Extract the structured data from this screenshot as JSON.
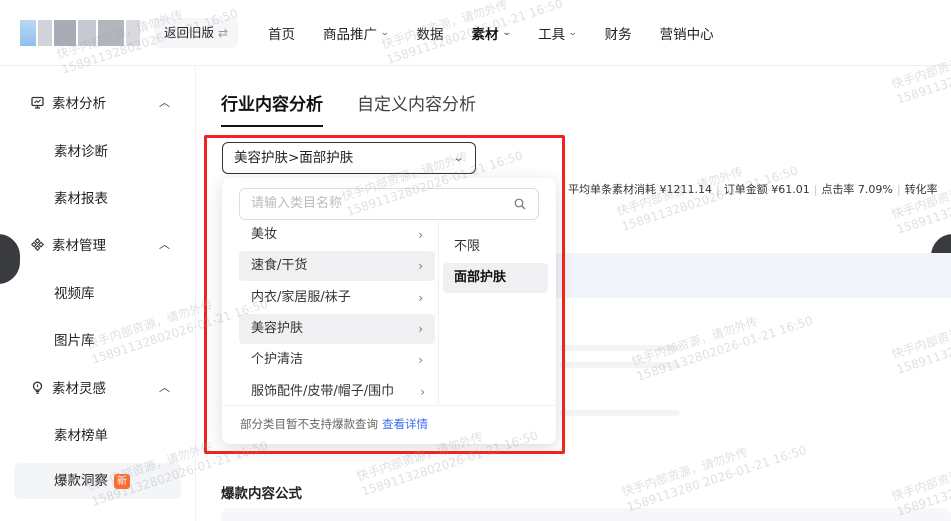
{
  "topbar": {
    "back_old_label": "返回旧版",
    "back_old_icon": "swap-icon",
    "nav": [
      {
        "label": "首页",
        "has_chevron": false,
        "active": false
      },
      {
        "label": "商品推广",
        "has_chevron": true,
        "active": false
      },
      {
        "label": "数据",
        "has_chevron": false,
        "active": false
      },
      {
        "label": "素材",
        "has_chevron": true,
        "active": true
      },
      {
        "label": "工具",
        "has_chevron": true,
        "active": false
      },
      {
        "label": "财务",
        "has_chevron": false,
        "active": false
      },
      {
        "label": "营销中心",
        "has_chevron": false,
        "active": false
      }
    ]
  },
  "sidebar": {
    "groups": [
      {
        "label": "素材分析",
        "icon": "monitor-icon",
        "items": [
          "素材诊断",
          "素材报表"
        ]
      },
      {
        "label": "素材管理",
        "icon": "grid-icon",
        "items": [
          "视频库",
          "图片库"
        ]
      },
      {
        "label": "素材灵感",
        "icon": "bulb-icon",
        "items": [
          "素材榜单",
          "爆款洞察"
        ]
      }
    ],
    "active_item": "爆款洞察",
    "new_badge": "新"
  },
  "main": {
    "tabs": [
      "行业内容分析",
      "自定义内容分析"
    ],
    "active_tab": "行业内容分析",
    "category_select": {
      "value": "美容护肤>面部护肤"
    },
    "stats": [
      "平均单条素材消耗 ¥1211.14",
      "订单金额 ¥61.01",
      "点击率 7.09%",
      "转化率"
    ],
    "section_title": "爆款内容公式"
  },
  "dropdown": {
    "search_placeholder": "请输入类目名称",
    "categories": [
      "美妆",
      "速食/干货",
      "内衣/家居服/袜子",
      "美容护肤",
      "个护清洁",
      "服饰配件/皮带/帽子/围巾"
    ],
    "subcategories": [
      "不限",
      "面部护肤"
    ],
    "selected_category": "美容护肤",
    "selected_subcategory": "面部护肤",
    "footer_text": "部分类目暂不支持爆款查询",
    "footer_link": "查看详情"
  },
  "watermark": {
    "line1": "快手内部资源，请勿外传",
    "line2": "15891132802026-01-21 16:50",
    "line2_spaced": "1589113280 2026-01-21 16:50"
  },
  "colors": {
    "highlight_box": "#f0241f",
    "link": "#3a6df0",
    "new_badge": "#ff6b2b"
  }
}
